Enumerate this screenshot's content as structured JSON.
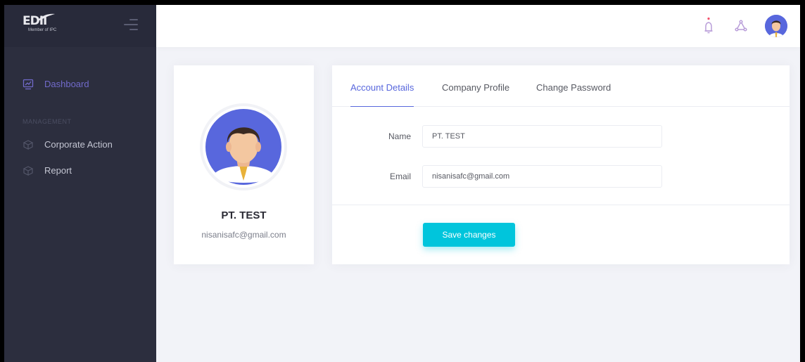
{
  "brand": {
    "logo_text": "EDII",
    "tagline": "Member of IPC"
  },
  "sidebar": {
    "items": [
      {
        "label": "Dashboard",
        "icon": "chart-icon",
        "active": true
      },
      {
        "label": "Corporate Action",
        "icon": "box-icon",
        "active": false
      },
      {
        "label": "Report",
        "icon": "box-icon",
        "active": false
      }
    ],
    "section_label": "MANAGEMENT"
  },
  "topbar": {
    "icons": [
      "bell-icon",
      "network-icon",
      "user-avatar"
    ]
  },
  "profile": {
    "name": "PT. TEST",
    "email": "nisanisafc@gmail.com"
  },
  "tabs": [
    {
      "label": "Account Details",
      "active": true
    },
    {
      "label": "Company Profile",
      "active": false
    },
    {
      "label": "Change Password",
      "active": false
    }
  ],
  "form": {
    "name_label": "Name",
    "name_value": "PT. TEST",
    "email_label": "Email",
    "email_value": "nisanisafc@gmail.com",
    "save_label": "Save changes"
  },
  "colors": {
    "accent": "#5867dd",
    "button": "#00c5dc",
    "sidebar_bg": "#2c2e3e",
    "notification": "#f4516c"
  }
}
